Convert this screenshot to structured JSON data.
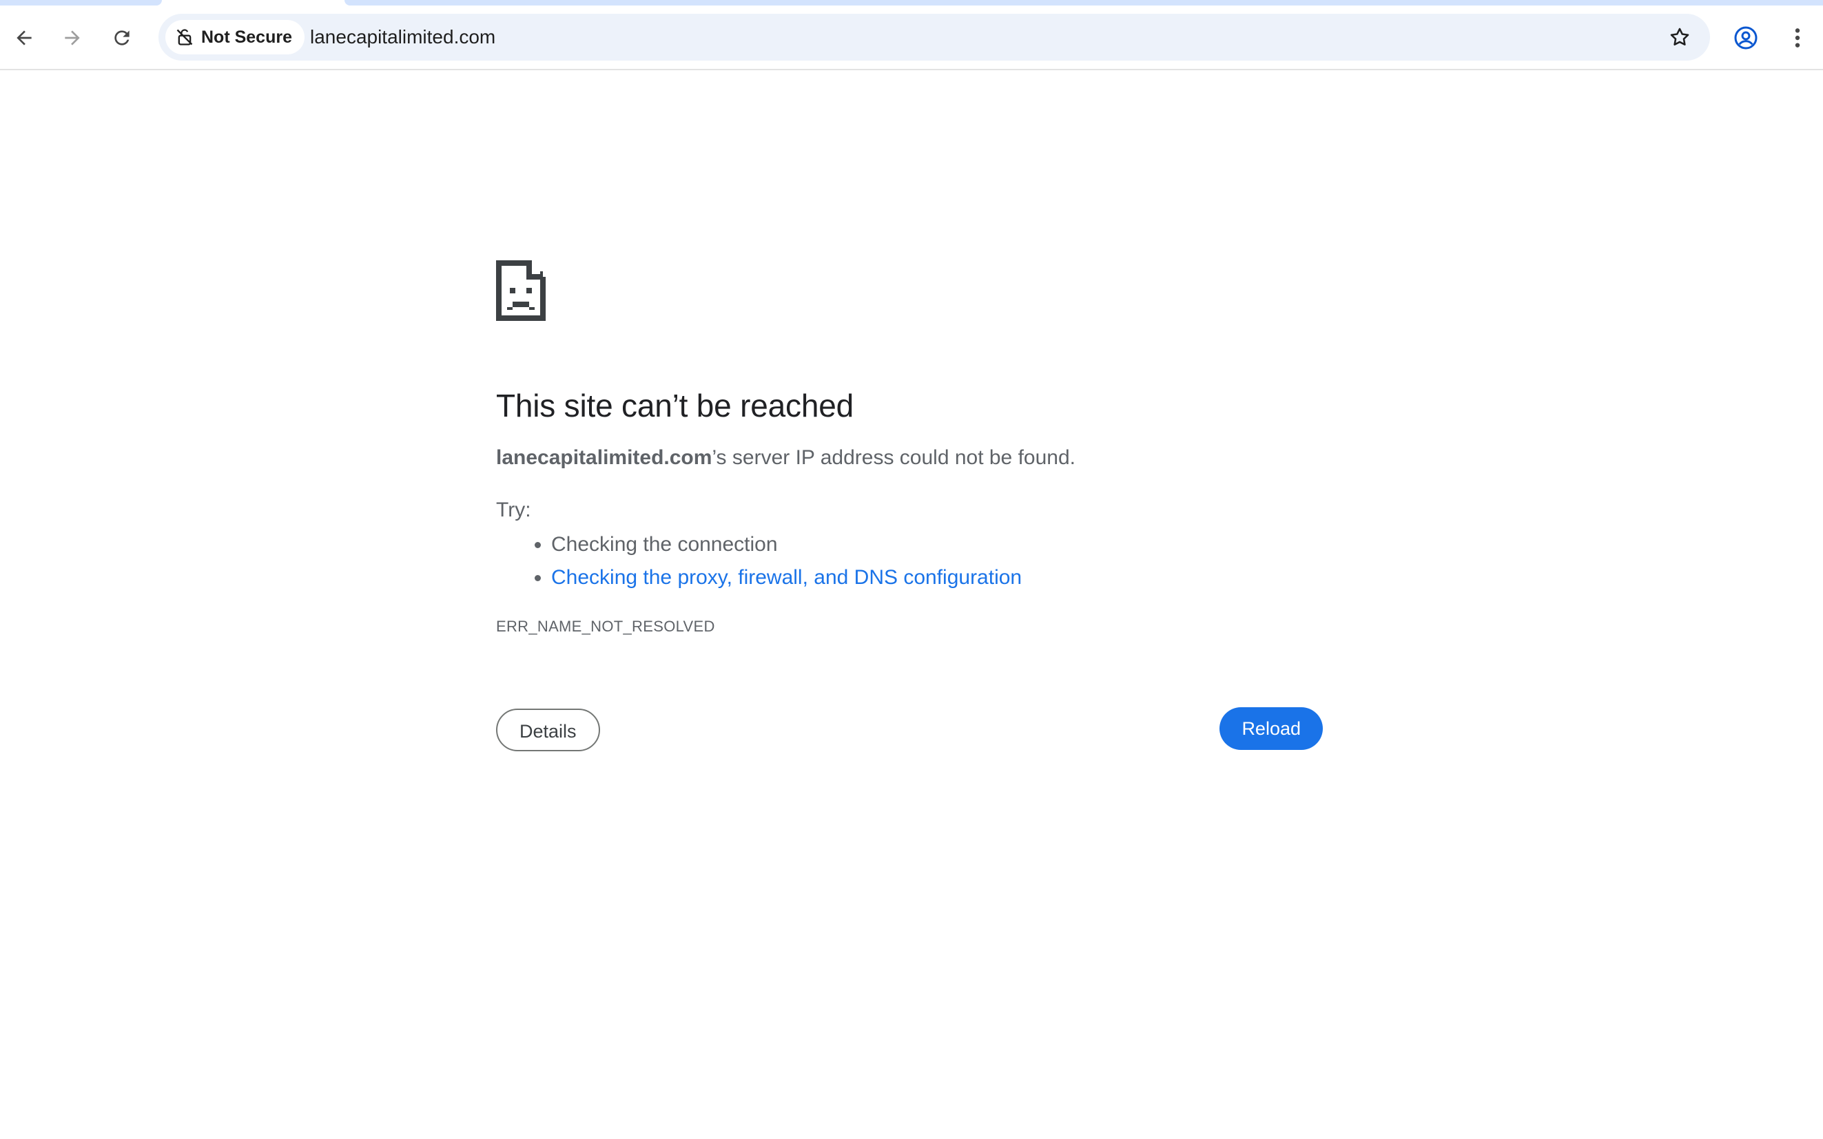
{
  "browser": {
    "security_chip_label": "Not Secure",
    "url": "lanecapitalimited.com",
    "icons": {
      "back": "arrow-back-icon",
      "forward": "arrow-forward-icon",
      "reload": "reload-icon",
      "security": "not-secure-icon",
      "bookmark": "star-icon",
      "profile": "profile-icon",
      "menu": "more-vert-icon"
    }
  },
  "error_page": {
    "icon": "sad-document-icon",
    "heading": "This site can’t be reached",
    "host": "lanecapitalimited.com",
    "description_suffix": "’s server IP address could not be found.",
    "try_label": "Try:",
    "suggestions": [
      "Checking the connection",
      "Checking the proxy, firewall, and DNS configuration"
    ],
    "error_code": "ERR_NAME_NOT_RESOLVED",
    "details_label": "Details",
    "reload_label": "Reload"
  },
  "colors": {
    "accent": "#1a73e8",
    "omnibox_bg": "#edf2fa",
    "text_secondary": "#5f6368",
    "text_primary": "#202124"
  }
}
